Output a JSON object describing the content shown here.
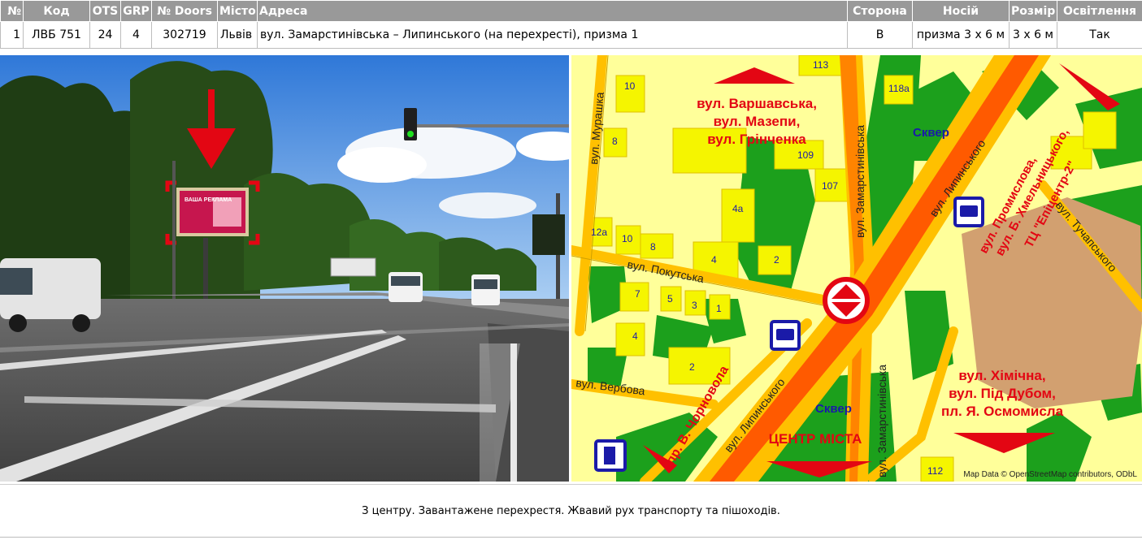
{
  "table": {
    "headers": [
      "№",
      "Код",
      "OTS",
      "GRP",
      "№ Doors",
      "Місто",
      "Адреса",
      "Сторона",
      "Носій",
      "Розмір",
      "Освітлення"
    ],
    "row": {
      "num": "1",
      "code": "ЛВБ 751",
      "ots": "24",
      "grp": "4",
      "doors": "302719",
      "city": "Львів",
      "address": "вул. Замарстинівська – Липинського (на перехресті), призма 1",
      "side": "B",
      "carrier": "призма 3 х 6 м",
      "size": "3 х 6 м",
      "lighting": "Так"
    }
  },
  "photo": {
    "billboard_text": "ВАША РЕКЛАМА"
  },
  "map": {
    "directions": {
      "north": [
        "вул. Варшавська,",
        "вул. Мазепи,",
        "вул. Грінченка"
      ],
      "south_east": [
        "вул. Хімічна,",
        "вул. Під Дубом,",
        "пл. Я. Осмомисла"
      ],
      "center": "ЦЕНТР МІСТА",
      "north_east": [
        "вул. Промислова,",
        "вул. Б. Хмельницького,",
        "ТЦ \"Епіцентр-2\""
      ],
      "chornovola": "пр. В. Чорновола"
    },
    "streets": {
      "murashka": "вул. Мурашка",
      "zamarstynivska": "вул. Замарстинівська",
      "lypynskoho": "вул. Липинського",
      "pokutska": "вул. Покутська",
      "verbova": "вул. Вербова",
      "tuchapskoho": "вул. Тучапського"
    },
    "squares": [
      "Сквер",
      "Сквер"
    ],
    "house_numbers": [
      "113",
      "10",
      "8",
      "118а",
      "109",
      "107",
      "4а",
      "12а",
      "10",
      "8",
      "4",
      "2",
      "7",
      "5",
      "3",
      "1",
      "4",
      "2",
      "112"
    ],
    "credit": "Map Data © OpenStreetMap contributors, ODbL",
    "colors": {
      "background": "#ffff9a",
      "main_road": "#ff6a00",
      "road": "#ffc000",
      "green": "#1ca01c",
      "building": "#f5f500",
      "label": "#e30613",
      "commercial": "#d2a070"
    }
  },
  "description": "З центру. Завантажене перехрестя. Жвавий рух транспорту та пішоходів."
}
